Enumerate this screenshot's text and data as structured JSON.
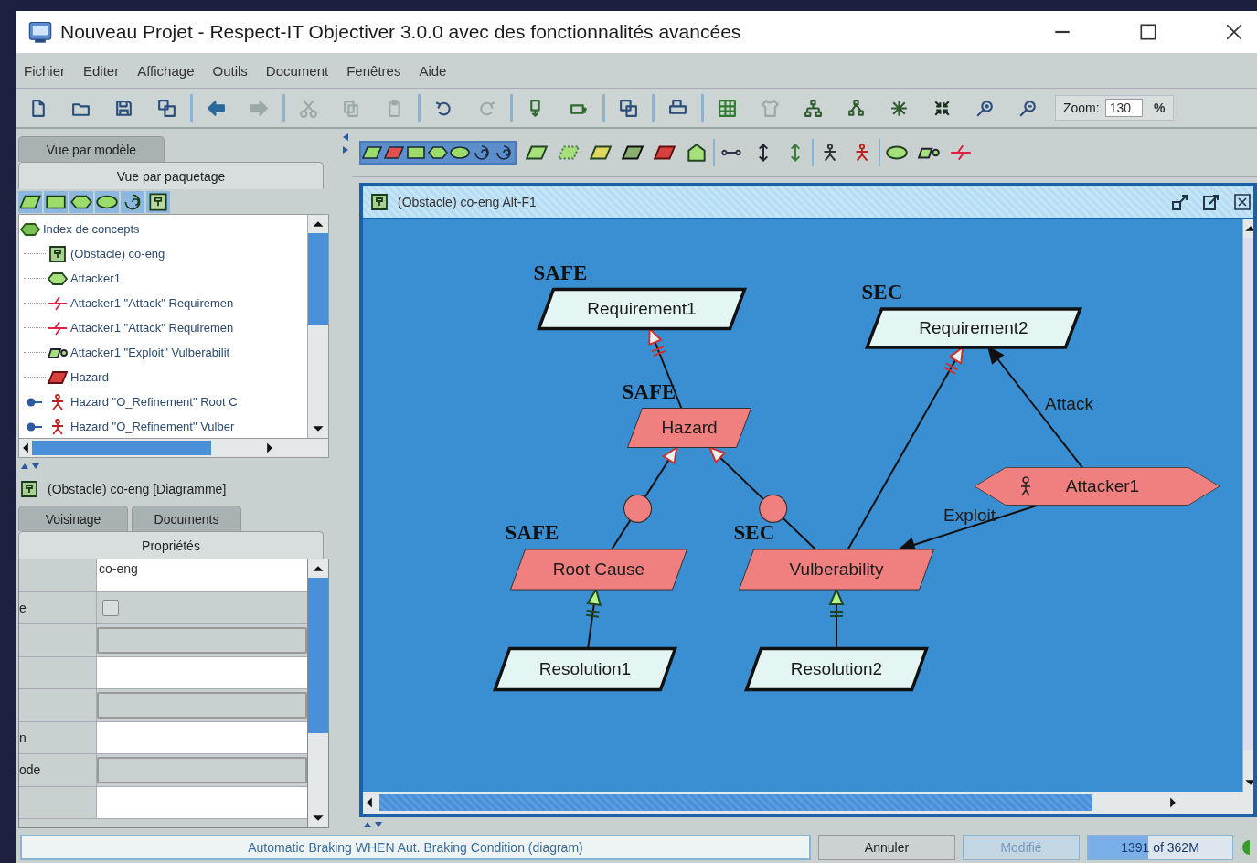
{
  "window": {
    "title": "Nouveau Projet - Respect-IT Objectiver 3.0.0  avec des fonctionnalités avancées"
  },
  "menu": [
    "Fichier",
    "Editer",
    "Affichage",
    "Outils",
    "Document",
    "Fenêtres",
    "Aide"
  ],
  "toolbar": {
    "groups": [
      [
        {
          "disabled": false
        },
        {
          "disabled": false
        },
        {
          "disabled": false
        },
        {
          "disabled": false
        }
      ],
      [
        {
          "disabled": false
        },
        {
          "disabled": true
        }
      ],
      [
        {
          "disabled": true
        },
        {
          "disabled": true
        },
        {
          "disabled": true
        }
      ],
      [
        {
          "disabled": false
        },
        {
          "disabled": true
        }
      ],
      [
        {
          "disabled": false
        },
        {
          "disabled": false
        }
      ],
      [
        {
          "disabled": false
        }
      ],
      [
        {
          "disabled": false
        }
      ],
      [
        {
          "disabled": false
        },
        {
          "disabled": true
        },
        {
          "disabled": false
        },
        {
          "disabled": false
        },
        {
          "disabled": false
        },
        {
          "disabled": false
        },
        {
          "disabled": false
        },
        {
          "disabled": false
        }
      ]
    ],
    "zoom_label": "Zoom:",
    "zoom_value": "130",
    "zoom_unit": "%"
  },
  "model_tabs": [
    {
      "label": "Vue par modèle",
      "selected": false
    },
    {
      "label": "Vue par paquetage",
      "selected": true
    }
  ],
  "filters": [
    {
      "selected": true
    },
    {
      "selected": true
    },
    {
      "selected": true
    },
    {
      "selected": true
    },
    {
      "selected": true
    },
    {
      "selected": true
    }
  ],
  "tree": [
    {
      "label": "Index de concepts",
      "kind": "index",
      "children": [
        {
          "label": "(Obstacle) co-eng",
          "kind": "diagram"
        },
        {
          "label": "Attacker1",
          "kind": "agent"
        },
        {
          "label": "Attacker1 \"Attack\" Requiremen",
          "kind": "attack"
        },
        {
          "label": "Attacker1 \"Attack\" Requiremen",
          "kind": "attack"
        },
        {
          "label": "Attacker1 \"Exploit\" Vulberabilit",
          "kind": "exploit"
        },
        {
          "label": "Hazard",
          "kind": "obstacle"
        },
        {
          "label": "Hazard \"O_Refinement\" Root C",
          "kind": "refinement"
        },
        {
          "label": "Hazard \"O_Refinement\" Vulber",
          "kind": "refinement"
        }
      ]
    }
  ],
  "selection": {
    "title": "(Obstacle) co-eng  [Diagramme]"
  },
  "detail_tabs": [
    {
      "label": "Voisinage",
      "selected": false
    },
    {
      "label": "Documents",
      "selected": false
    },
    {
      "label": "Propriétés",
      "selected": true
    }
  ],
  "properties": [
    {
      "kind": "text",
      "value": "co-eng"
    },
    {
      "label": "e",
      "kind": "checkbox",
      "checked": false
    },
    {
      "kind": "dropdown"
    },
    {
      "kind": "text"
    },
    {
      "kind": "dropdown"
    },
    {
      "label": "n",
      "kind": "text"
    },
    {
      "label": "ode",
      "kind": "dropdown"
    },
    {
      "kind": "text"
    }
  ],
  "palette": {
    "filters": [
      {
        "selected": true
      },
      {
        "selected": true
      },
      {
        "selected": true
      },
      {
        "selected": true
      },
      {
        "selected": true
      },
      {
        "selected": true
      },
      {
        "selected": true
      }
    ]
  },
  "diagram": {
    "title": "(Obstacle) co-eng  Alt-F1",
    "nodes": [
      {
        "label": "Requirement1",
        "kind": "requirement",
        "tag": "SAFE"
      },
      {
        "label": "Requirement2",
        "kind": "requirement",
        "tag": "SEC"
      },
      {
        "label": "Hazard",
        "kind": "obstacle",
        "tag": "SAFE"
      },
      {
        "label": "Root Cause",
        "kind": "obstacle",
        "tag": "SAFE"
      },
      {
        "label": "Vulberability",
        "kind": "obstacle",
        "tag": "SEC"
      },
      {
        "label": "Attacker1",
        "kind": "agent"
      },
      {
        "label": "Resolution1",
        "kind": "requirement"
      },
      {
        "label": "Resolution2",
        "kind": "requirement"
      }
    ],
    "links": [
      {
        "kind": "refinement"
      },
      {
        "kind": "or-refinement"
      },
      {
        "kind": "or-refinement"
      },
      {
        "kind": "obstruction"
      },
      {
        "kind": "attack",
        "label": "Attack"
      },
      {
        "kind": "exploit",
        "label": "Exploit"
      },
      {
        "kind": "resolution"
      },
      {
        "kind": "resolution"
      }
    ]
  },
  "status_bar": {
    "message": "Automatic Braking WHEN Aut. Braking Condition (diagram)",
    "buttons": [
      {
        "label": "Annuler",
        "disabled": false
      },
      {
        "label": "Modifié",
        "disabled": true
      }
    ],
    "memory": {
      "text": "1391 of 362M",
      "level": 0.42
    }
  }
}
